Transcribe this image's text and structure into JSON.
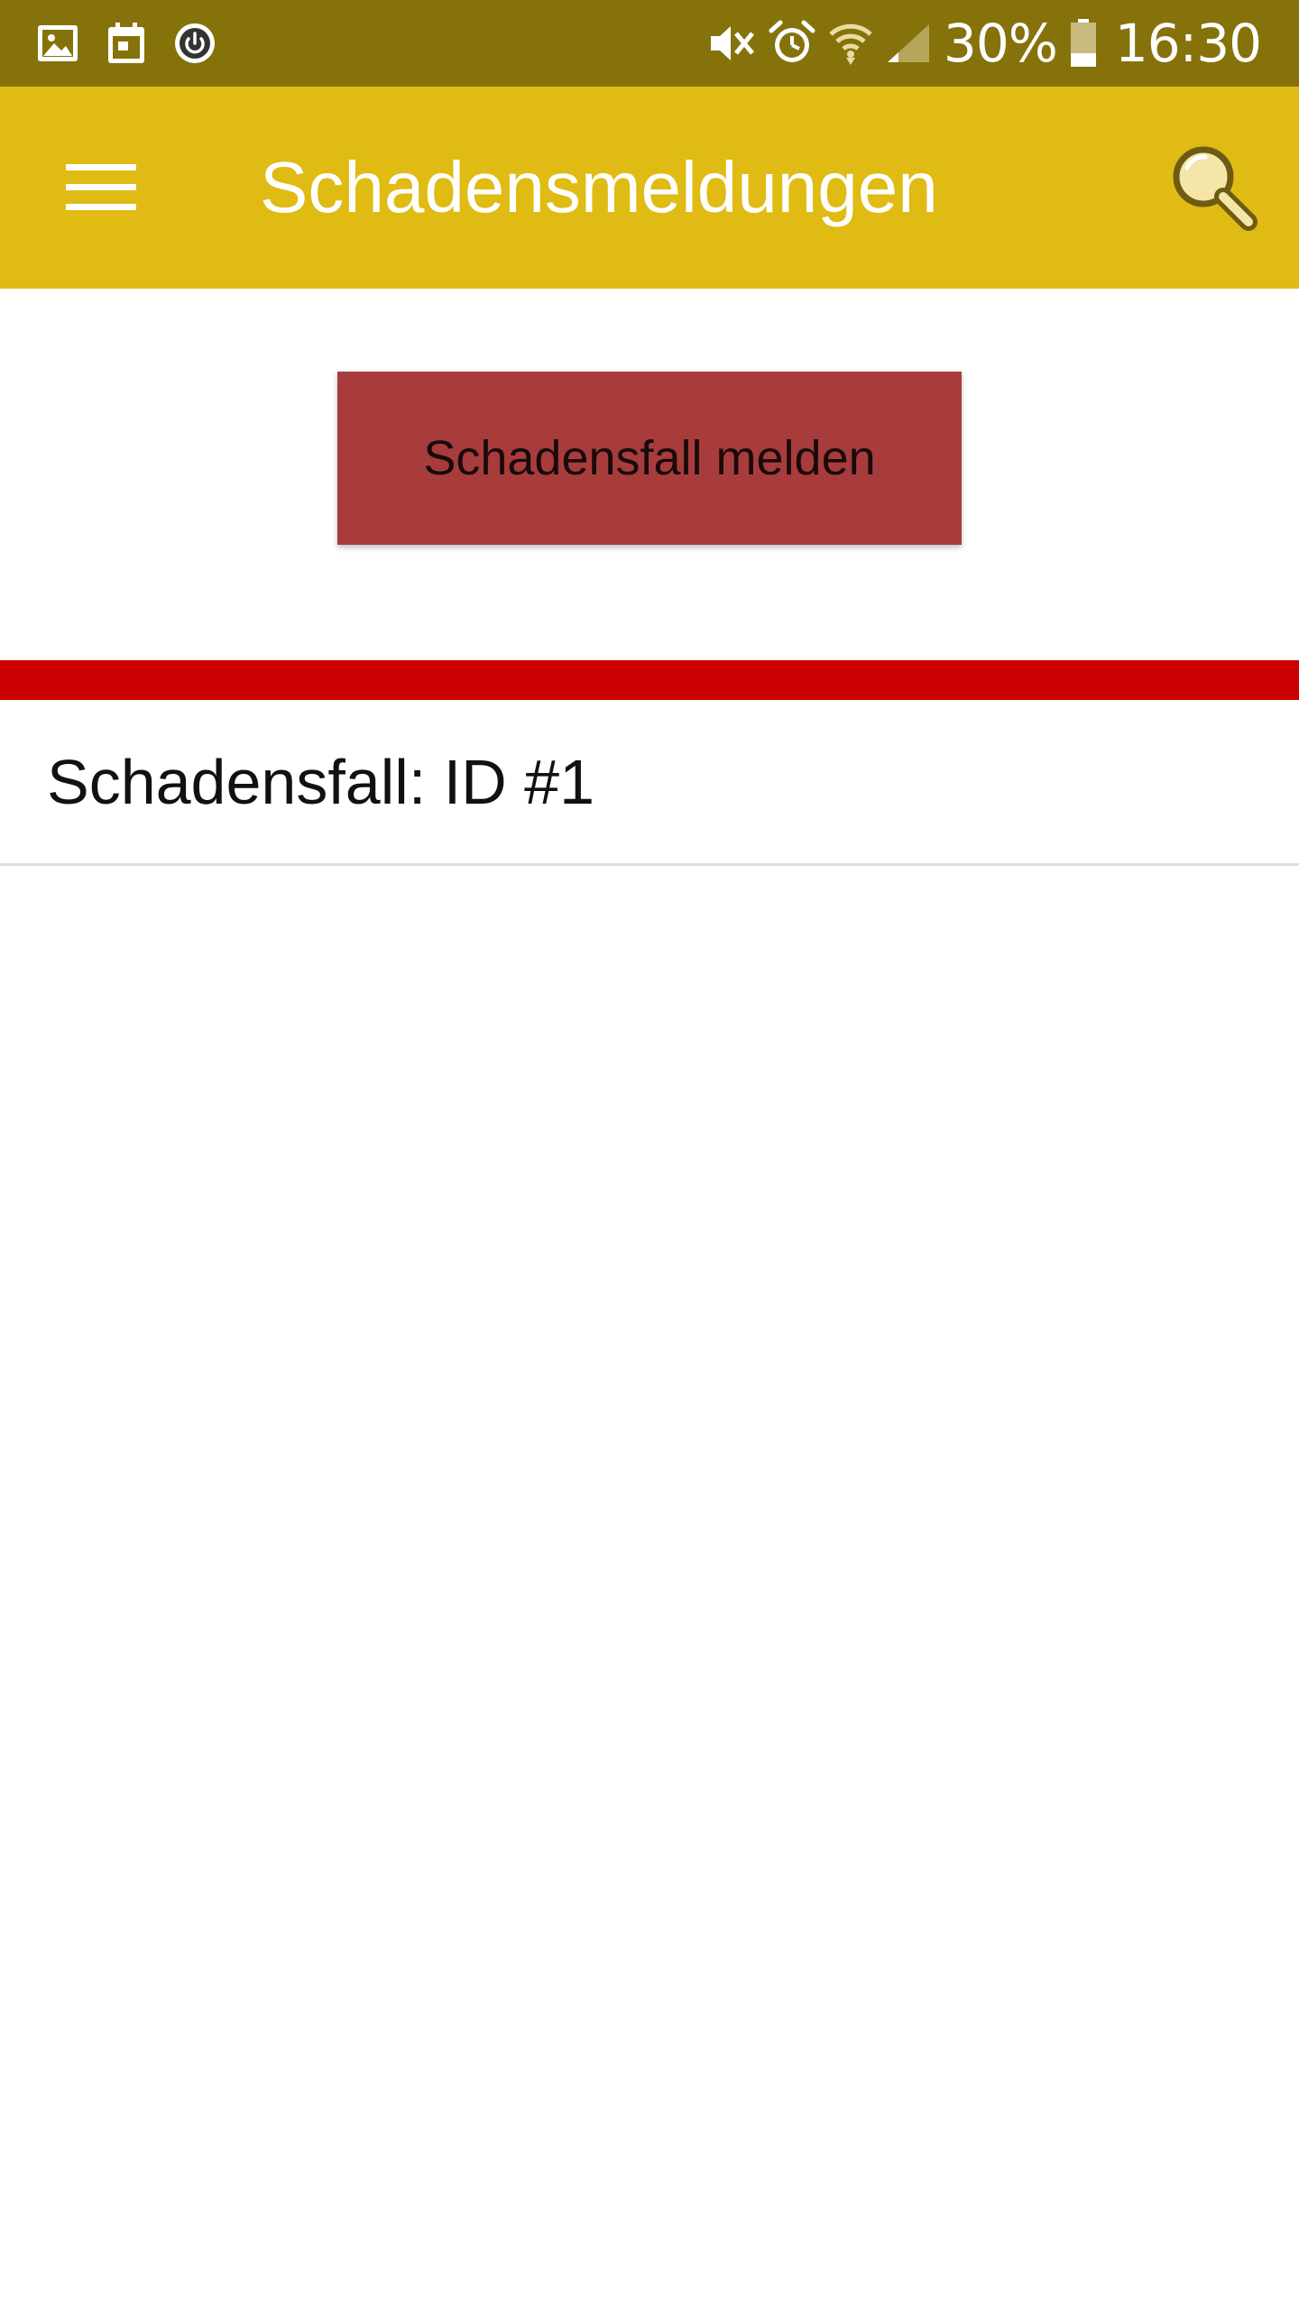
{
  "status_bar": {
    "left_icons": [
      "gallery-icon",
      "calendar-icon",
      "power-icon"
    ],
    "right_icons": [
      "mute-icon",
      "alarm-icon",
      "wifi-icon",
      "signal-icon",
      "battery-icon"
    ],
    "battery_percent": "30%",
    "battery_level": 0.3,
    "time": "16:30"
  },
  "app_bar": {
    "title": "Schadensmeldungen",
    "menu_icon": "hamburger-menu-icon",
    "search_icon": "search-icon"
  },
  "main": {
    "report_button_label": "Schadensfall melden",
    "cases": [
      {
        "label": "Schadensfall: ID #1"
      }
    ]
  },
  "colors": {
    "status_bar": "#86720b",
    "app_bar": "#dfbb13",
    "report_button": "#a83c3c",
    "divider": "#cc0000"
  }
}
